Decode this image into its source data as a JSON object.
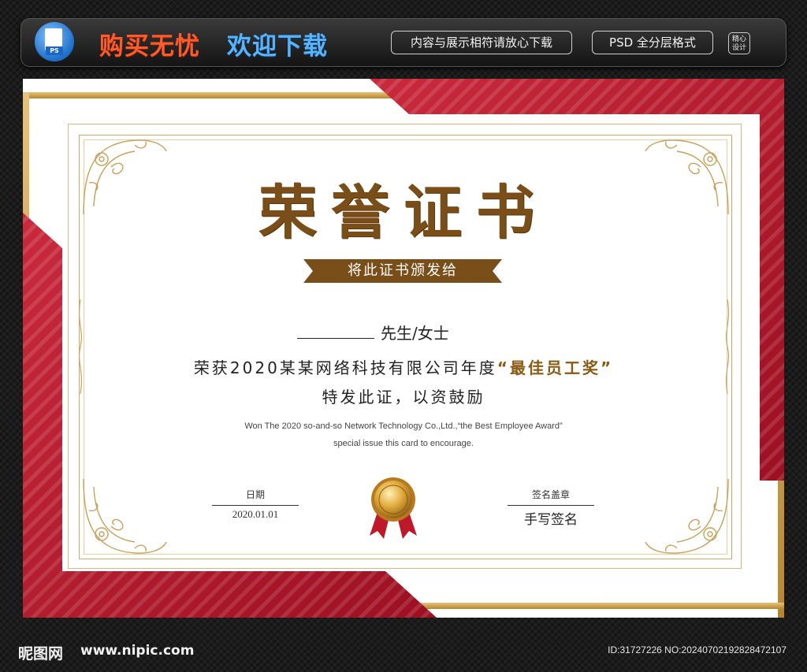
{
  "banner": {
    "slogan_buy": "购买无忧",
    "slogan_welcome": "欢迎下载",
    "tag_content": "内容与展示相符请放心下载",
    "tag_format": "PSD 全分层格式",
    "tag_design_line1": "精心",
    "tag_design_line2": "设计",
    "ps_label": "PS"
  },
  "certificate": {
    "title": "荣誉证书",
    "ribbon_text": "将此证书颁发给",
    "name_suffix": "先生/女士",
    "award_prefix": "荣获2020某某网络科技有限公司年度",
    "award_name": "“最佳员工奖”",
    "award_line2": "特发此证，以资鼓励",
    "english_line1": "Won The 2020 so-and-so Network Technology Co.,Ltd.,“the Best Employee Award”",
    "english_line2": "special issue this card to encourage.",
    "date_label": "日期",
    "date_value": "2020.01.01",
    "signature_label": "签名盖章",
    "signature_value": "手写签名"
  },
  "footer": {
    "site_logo": "昵图网",
    "site_url": "www.nipic.com",
    "image_id": "ID:31727226 NO:20240702192828472107"
  },
  "colors": {
    "red": "#b5192b",
    "gold": "#c79a45",
    "brown": "#7a4e18"
  }
}
